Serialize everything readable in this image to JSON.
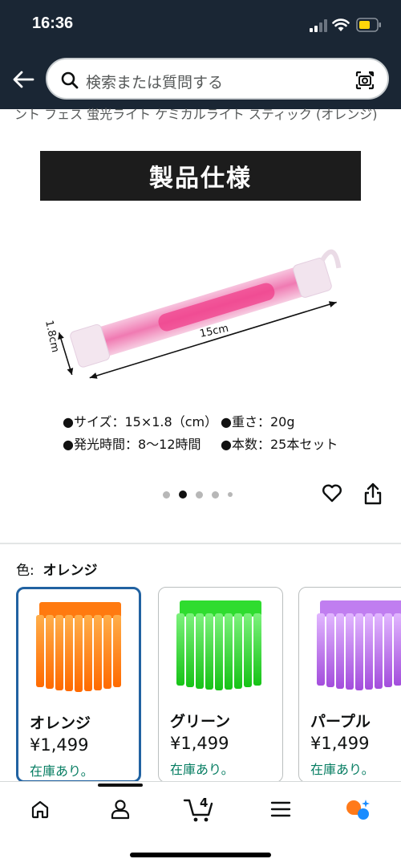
{
  "status_bar": {
    "time": "16:36"
  },
  "search": {
    "placeholder": "検索または質問する"
  },
  "product": {
    "title_fragment": "ント フェス 蛍光ライト ケミカルライト スティック (オレンジ)",
    "image_banner": "製品仕様",
    "image_dim_length": "15cm",
    "image_dim_width": "1.8cm",
    "spec_line_1_left": "●サイズ：15×1.8（cm）",
    "spec_line_1_right": "●重さ：20g",
    "spec_line_2_left": "●発光時間：8〜12時間",
    "spec_line_2_right": "●本数：25本セット",
    "carousel_count": 5,
    "carousel_active": 2
  },
  "color_selector": {
    "label": "色:",
    "selected": "オレンジ",
    "options": [
      {
        "name": "オレンジ",
        "price": "¥1,499",
        "stock": "在庫あり。",
        "color": "#ff8a1e"
      },
      {
        "name": "グリーン",
        "price": "¥1,499",
        "stock": "在庫あり。",
        "color": "#3ddc3d"
      },
      {
        "name": "パープル",
        "price": "¥1,499",
        "stock": "在庫あり。",
        "color": "#b56ae8"
      }
    ]
  },
  "tab_bar": {
    "cart_count": "4"
  },
  "colors": {
    "header_bg": "#1a2634",
    "selected_border": "#2162a1",
    "stock_green": "#067d62"
  }
}
